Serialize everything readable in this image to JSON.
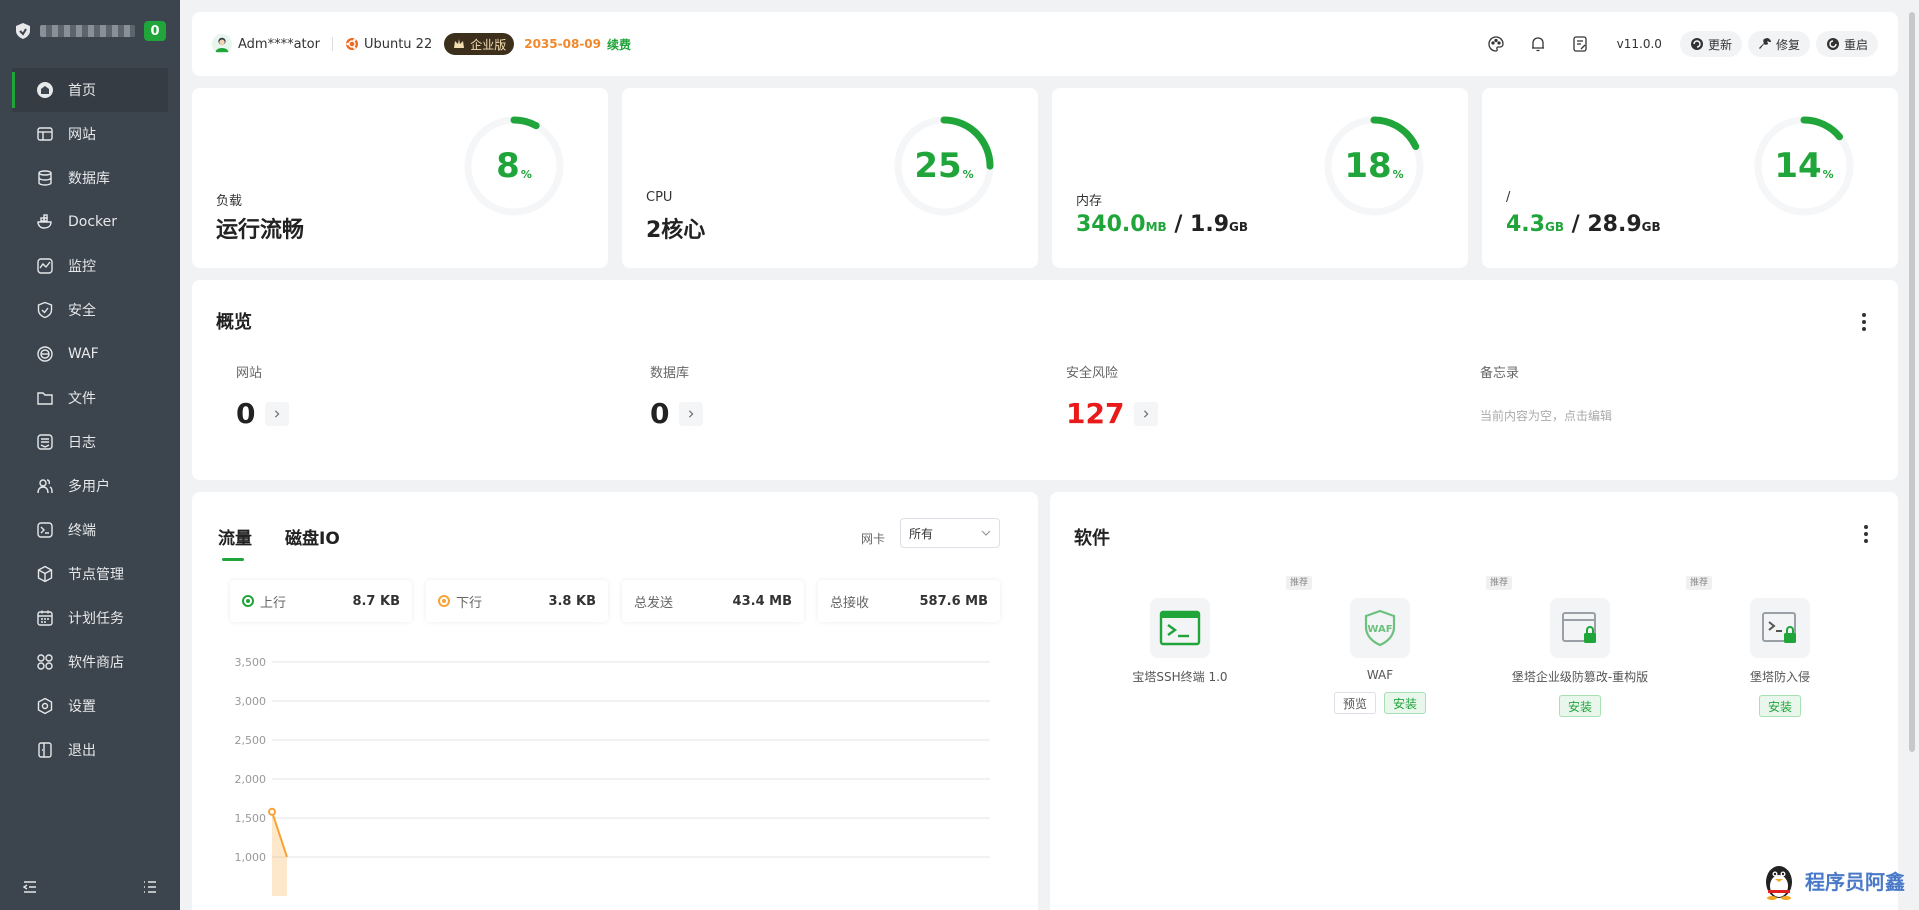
{
  "sidebar": {
    "badge": "0",
    "items": [
      {
        "label": "首页",
        "icon": "home-icon"
      },
      {
        "label": "网站",
        "icon": "website-icon"
      },
      {
        "label": "数据库",
        "icon": "database-icon"
      },
      {
        "label": "Docker",
        "icon": "docker-icon"
      },
      {
        "label": "监控",
        "icon": "monitor-icon"
      },
      {
        "label": "安全",
        "icon": "security-icon"
      },
      {
        "label": "WAF",
        "icon": "waf-icon"
      },
      {
        "label": "文件",
        "icon": "folder-icon"
      },
      {
        "label": "日志",
        "icon": "log-icon"
      },
      {
        "label": "多用户",
        "icon": "users-icon"
      },
      {
        "label": "终端",
        "icon": "terminal-icon"
      },
      {
        "label": "节点管理",
        "icon": "node-icon"
      },
      {
        "label": "计划任务",
        "icon": "calendar-icon"
      },
      {
        "label": "软件商店",
        "icon": "store-icon"
      },
      {
        "label": "设置",
        "icon": "settings-icon"
      },
      {
        "label": "退出",
        "icon": "logout-icon"
      }
    ]
  },
  "header": {
    "user": "Adm****ator",
    "os": "Ubuntu 22",
    "edition": "企业版",
    "expire": "2035-08-09",
    "renew": "续费",
    "version": "v11.0.0",
    "buttons": {
      "update": "更新",
      "repair": "修复",
      "restart": "重启"
    }
  },
  "stats": [
    {
      "label": "负载",
      "value": "运行流畅",
      "percent": "8",
      "unit": "%"
    },
    {
      "label": "CPU",
      "value": "2核心",
      "percent": "25",
      "unit": "%"
    },
    {
      "label": "内存",
      "used": "340.0",
      "used_unit": "MB",
      "sep": " / ",
      "total": "1.9",
      "total_unit": "GB",
      "percent": "18",
      "unit": "%"
    },
    {
      "label": "/",
      "used": "4.3",
      "used_unit": "GB",
      "sep": " / ",
      "total": "28.9",
      "total_unit": "GB",
      "percent": "14",
      "unit": "%"
    }
  ],
  "overview": {
    "title": "概览",
    "website": {
      "label": "网站",
      "count": "0"
    },
    "database": {
      "label": "数据库",
      "count": "0"
    },
    "risk": {
      "label": "安全风险",
      "count": "127"
    },
    "memo": {
      "label": "备忘录",
      "text": "当前内容为空，点击编辑"
    }
  },
  "traffic": {
    "tabs": [
      "流量",
      "磁盘IO"
    ],
    "nic_label": "网卡",
    "nic_value": "所有",
    "stats": [
      {
        "label": "上行",
        "value": "8.7 KB"
      },
      {
        "label": "下行",
        "value": "3.8 KB"
      },
      {
        "label": "总发送",
        "value": "43.4 MB"
      },
      {
        "label": "总接收",
        "value": "587.6 MB"
      }
    ]
  },
  "chart_data": {
    "type": "line",
    "y_ticks": [
      "3,500",
      "3,000",
      "2,500",
      "2,000",
      "1,500",
      "1,000"
    ],
    "ylim": [
      1000,
      3500
    ],
    "series": [
      {
        "color": "#f7a335",
        "x": [
          0,
          0.3
        ],
        "values": [
          1580,
          1000
        ]
      }
    ]
  },
  "software": {
    "title": "软件",
    "rec_label": "推荐",
    "items": [
      {
        "name": "宝塔SSH终端 1.0",
        "install": "",
        "preview": ""
      },
      {
        "name": "WAF",
        "install": "安装",
        "preview": "预览"
      },
      {
        "name": "堡塔企业级防篡改-重构版",
        "install": "安装",
        "preview": ""
      },
      {
        "name": "堡塔防入侵",
        "install": "安装",
        "preview": ""
      }
    ]
  },
  "watermark": {
    "text": "程序员阿鑫"
  },
  "colors": {
    "accent": "#20a53a",
    "danger": "#e81a1a",
    "upload": "#20a53a",
    "download": "#f7a335"
  }
}
